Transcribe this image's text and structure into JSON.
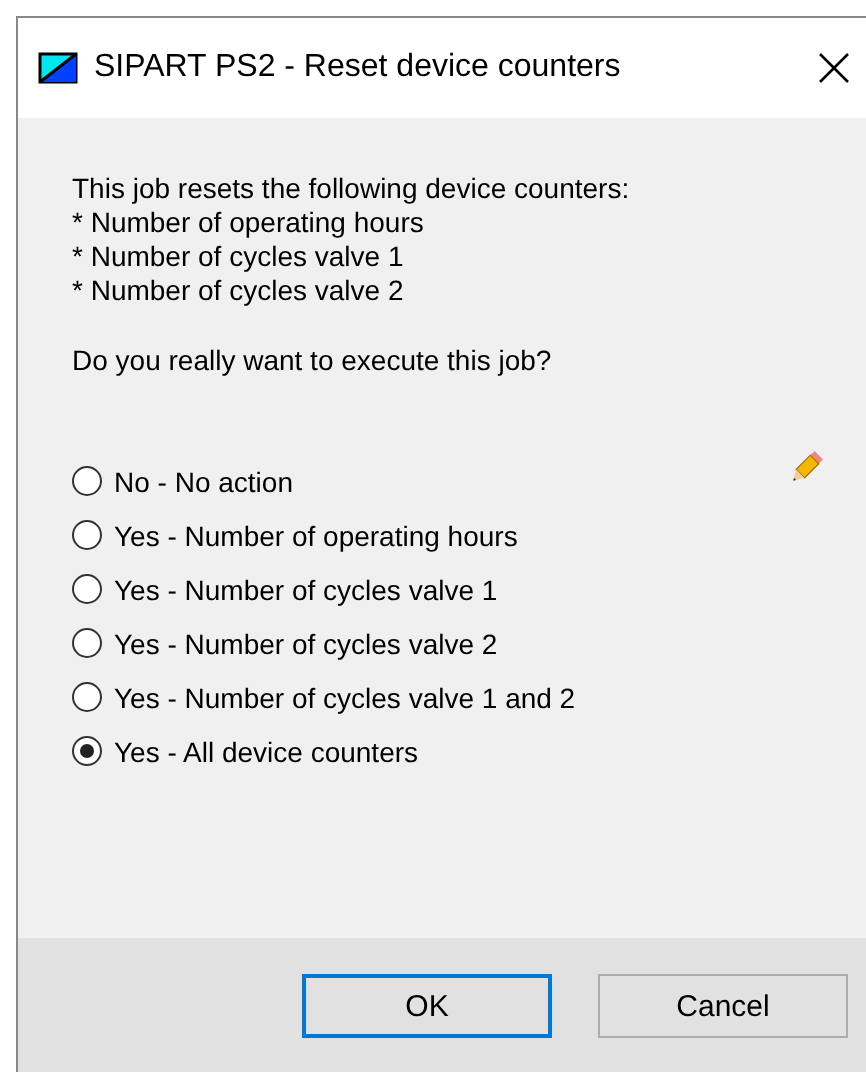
{
  "window": {
    "title": "SIPART PS2 - Reset device counters"
  },
  "intro": [
    "This job resets the following device counters:",
    " * Number of operating hours",
    " * Number of cycles valve 1",
    " * Number of cycles valve 2"
  ],
  "question": "Do you really want to execute this job?",
  "options": [
    {
      "label": "No - No action",
      "selected": false
    },
    {
      "label": "Yes - Number of operating hours",
      "selected": false
    },
    {
      "label": "Yes - Number of cycles valve 1",
      "selected": false
    },
    {
      "label": "Yes - Number of cycles valve 2",
      "selected": false
    },
    {
      "label": "Yes - Number of cycles valve 1 and 2",
      "selected": false
    },
    {
      "label": "Yes - All device counters",
      "selected": true
    }
  ],
  "buttons": [
    {
      "label": "OK",
      "default": true
    },
    {
      "label": "Cancel",
      "default": false
    }
  ]
}
